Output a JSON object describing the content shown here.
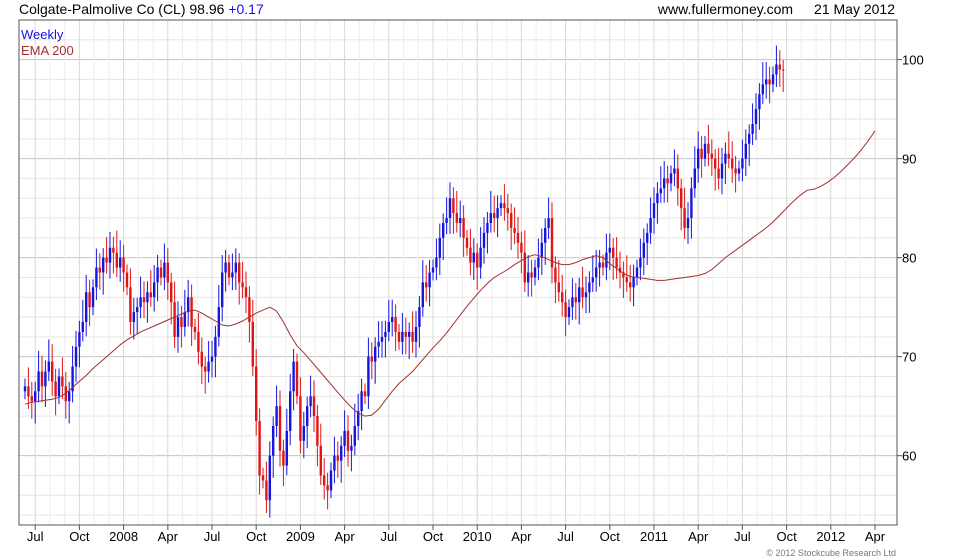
{
  "header": {
    "instrument": "Colgate-Palmolive Co (CL) 98.96",
    "change": "+0.17",
    "site": "www.fullermoney.com",
    "date": "21 May 2012"
  },
  "legend": {
    "line1": "Weekly",
    "line2": "EMA 200"
  },
  "copyright": "© 2012 Stockcube Research Ltd",
  "colors": {
    "up": "#1515e0",
    "down": "#e01515",
    "ema": "#a03030",
    "grid": "#d8d8d8"
  },
  "chart_data": {
    "type": "line",
    "title": "Colgate-Palmolive Co (CL) 98.96",
    "subtitle": "+0.17",
    "ylim": [
      53,
      104
    ],
    "yticks": [
      60,
      70,
      80,
      90,
      100
    ],
    "x_tick_labels": [
      "Jul",
      "Oct",
      "2008",
      "Apr",
      "Jul",
      "Oct",
      "2009",
      "Apr",
      "Jul",
      "Oct",
      "2010",
      "Apr",
      "Jul",
      "Oct",
      "2011",
      "Apr",
      "Jul",
      "Oct",
      "2012",
      "Apr"
    ],
    "x_tick_weeks": [
      3,
      16,
      29,
      42,
      55,
      68,
      81,
      94,
      107,
      120,
      133,
      146,
      159,
      172,
      185,
      198,
      211,
      224,
      237,
      250
    ],
    "grid": true,
    "legend_position": "top-left",
    "series": [
      {
        "name": "Weekly",
        "style": "bars",
        "close": [
          67.0,
          66.0,
          65.5,
          66.5,
          68.5,
          67.0,
          68.5,
          69.5,
          67.5,
          66.0,
          68.0,
          67.0,
          65.5,
          66.5,
          69.0,
          71.0,
          72.5,
          73.5,
          76.5,
          75.0,
          77.0,
          79.0,
          78.5,
          80.0,
          79.5,
          81.0,
          80.5,
          79.0,
          80.0,
          78.5,
          77.0,
          73.5,
          74.5,
          75.0,
          76.0,
          75.5,
          76.5,
          76.0,
          77.5,
          79.0,
          78.0,
          79.5,
          77.5,
          75.5,
          72.0,
          74.0,
          73.0,
          74.5,
          76.0,
          73.0,
          72.5,
          70.5,
          69.0,
          68.5,
          69.5,
          70.0,
          72.0,
          75.0,
          78.5,
          79.5,
          78.0,
          78.5,
          79.5,
          77.5,
          77.0,
          76.0,
          73.5,
          69.0,
          63.5,
          58.0,
          57.5,
          55.5,
          60.0,
          63.0,
          65.0,
          60.5,
          59.0,
          62.5,
          66.5,
          69.5,
          66.0,
          61.5,
          63.0,
          65.0,
          66.0,
          64.0,
          61.0,
          58.0,
          57.0,
          56.5,
          58.5,
          60.0,
          59.5,
          61.0,
          62.5,
          60.5,
          61.0,
          63.0,
          64.5,
          66.5,
          66.0,
          70.0,
          69.5,
          71.0,
          71.5,
          72.0,
          72.5,
          73.5,
          74.0,
          72.5,
          71.5,
          72.5,
          72.0,
          72.5,
          71.5,
          73.0,
          75.0,
          77.5,
          77.0,
          78.5,
          79.0,
          80.0,
          82.0,
          83.5,
          84.0,
          86.0,
          84.5,
          83.5,
          84.0,
          82.0,
          81.0,
          79.5,
          80.5,
          79.0,
          81.0,
          82.5,
          83.5,
          84.5,
          84.0,
          85.0,
          85.5,
          85.0,
          84.5,
          83.0,
          82.5,
          81.5,
          80.5,
          77.5,
          78.5,
          78.0,
          79.0,
          80.0,
          81.5,
          83.0,
          84.0,
          79.0,
          77.5,
          76.5,
          75.5,
          74.0,
          75.0,
          76.0,
          75.5,
          77.0,
          76.0,
          76.5,
          77.5,
          78.0,
          79.0,
          79.5,
          79.0,
          80.5,
          81.0,
          80.0,
          79.0,
          78.5,
          78.0,
          77.5,
          77.0,
          78.0,
          79.0,
          80.0,
          81.5,
          82.5,
          84.0,
          85.5,
          86.5,
          87.0,
          88.0,
          87.5,
          88.5,
          89.0,
          87.0,
          85.0,
          83.0,
          84.0,
          87.0,
          89.0,
          91.0,
          90.0,
          91.5,
          90.5,
          90.0,
          89.0,
          88.0,
          89.5,
          90.5,
          90.0,
          89.0,
          88.5,
          89.0,
          90.0,
          91.5,
          92.5,
          93.5,
          95.0,
          96.5,
          97.5,
          98.0,
          97.5,
          98.5,
          99.5,
          99.0,
          98.96
        ]
      },
      {
        "name": "EMA 200",
        "style": "line",
        "values": [
          65.2,
          65.4,
          65.5,
          65.6,
          65.7,
          65.9,
          66.3,
          66.9,
          67.5,
          68.1,
          68.8,
          69.4,
          70.0,
          70.6,
          71.2,
          71.7,
          72.1,
          72.5,
          72.8,
          73.1,
          73.4,
          73.7,
          74.0,
          74.3,
          74.6,
          74.7,
          74.4,
          74.0,
          73.6,
          73.2,
          73.1,
          73.3,
          73.6,
          74.0,
          74.4,
          74.7,
          75.0,
          74.6,
          73.5,
          72.2,
          71.1,
          70.4,
          69.6,
          68.8,
          68.0,
          67.2,
          66.4,
          65.6,
          64.9,
          64.3,
          64.0,
          64.1,
          64.7,
          65.6,
          66.5,
          67.3,
          67.9,
          68.5,
          69.3,
          70.1,
          70.9,
          71.6,
          72.4,
          73.3,
          74.2,
          75.1,
          75.9,
          76.7,
          77.4,
          78.0,
          78.4,
          78.8,
          79.3,
          79.7,
          80.1,
          80.3,
          80.1,
          79.8,
          79.5,
          79.3,
          79.3,
          79.5,
          79.8,
          80.0,
          80.2,
          80.0,
          79.4,
          78.9,
          78.4,
          78.1,
          78.0,
          77.9,
          77.8,
          77.7,
          77.7,
          77.8,
          77.9,
          78.0,
          78.1,
          78.2,
          78.4,
          78.8,
          79.4,
          80.0,
          80.5,
          81.0,
          81.5,
          82.0,
          82.5,
          83.0,
          83.6,
          84.3,
          85.0,
          85.7,
          86.3,
          86.8,
          86.9,
          87.2,
          87.6,
          88.1,
          88.7,
          89.4,
          90.1,
          90.9,
          91.8,
          92.8
        ]
      }
    ]
  }
}
